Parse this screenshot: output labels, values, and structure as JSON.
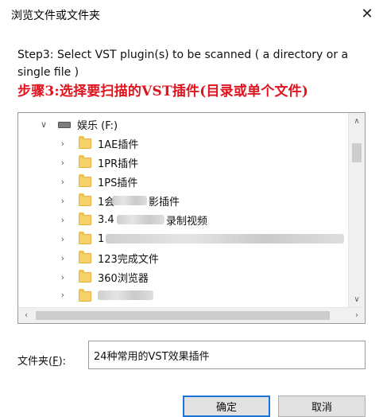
{
  "window": {
    "title": "浏览文件或文件夹",
    "close_glyph": "✕"
  },
  "instruction_en": "Step3: Select VST plugin(s) to be scanned ( a directory or a single file )",
  "instruction_cn": "步骤3:选择要扫描的VST插件(目录或单个文件)",
  "tree": {
    "drive": {
      "label": "娱乐 (F:)",
      "expanded": true
    },
    "folders": [
      {
        "label": "1AE插件"
      },
      {
        "label": "1PR插件"
      },
      {
        "label": "1PS插件"
      },
      {
        "label": "1会",
        "label_tail": "影插件"
      },
      {
        "label": "3.4",
        "label_tail": "录制视频"
      },
      {
        "label": "1"
      },
      {
        "label": "123完成文件"
      },
      {
        "label": "360浏览器"
      },
      {
        "label": ""
      }
    ]
  },
  "folder_field": {
    "label_prefix": "文件夹(",
    "label_hotkey": "F",
    "label_suffix": "):",
    "value": "24种常用的VST效果插件"
  },
  "buttons": {
    "ok": "确定",
    "cancel": "取消"
  }
}
